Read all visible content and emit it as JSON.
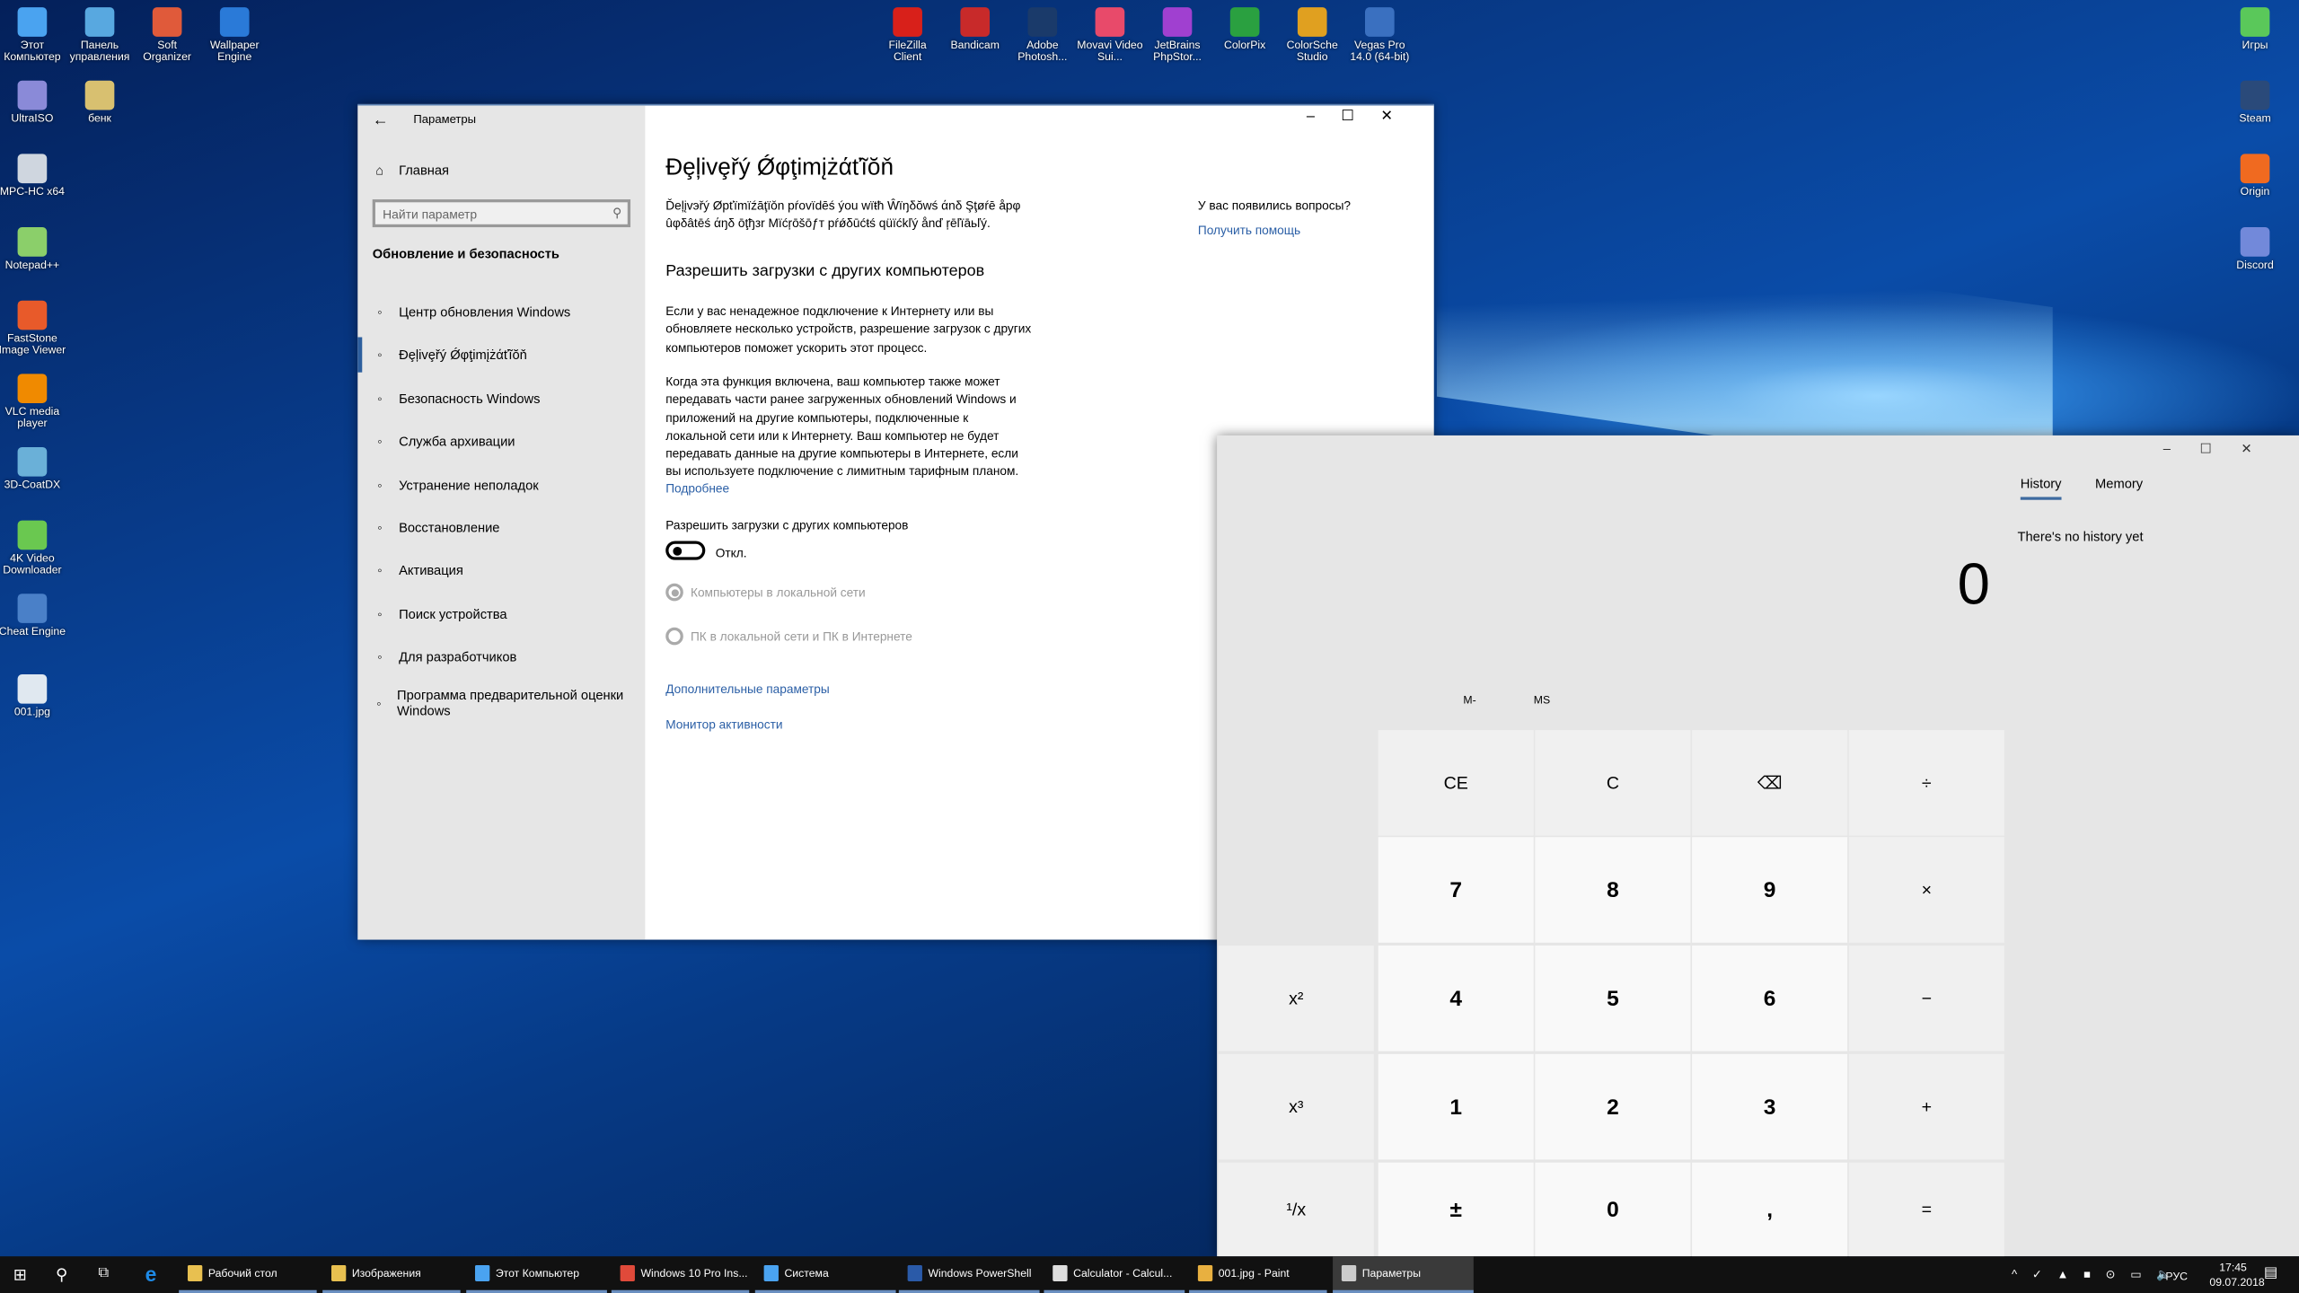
{
  "desktop": {
    "left_icons": [
      {
        "label": "Этот Компьютер",
        "icon": "computer-icon",
        "color": "#4aa3f0"
      },
      {
        "label": "UltraISO",
        "icon": "disc-icon",
        "color": "#8a8ad8"
      },
      {
        "label": "MPC-HC x64",
        "icon": "film-icon",
        "color": "#cfd6df"
      },
      {
        "label": "Notepad++",
        "icon": "notepad-icon",
        "color": "#8bcf6a"
      },
      {
        "label": "FastStone Image Viewer",
        "icon": "image-viewer-icon",
        "color": "#e85a2a"
      },
      {
        "label": "VLC media player",
        "icon": "vlc-cone-icon",
        "color": "#f08a00"
      },
      {
        "label": "3D-CoatDX",
        "icon": "3d-coat-icon",
        "color": "#6ab0d8"
      },
      {
        "label": "4K Video Downloader",
        "icon": "download-icon",
        "color": "#6ac850"
      },
      {
        "label": "Cheat Engine",
        "icon": "cheat-engine-icon",
        "color": "#4a80c8"
      },
      {
        "label": "001.jpg",
        "icon": "image-file-icon",
        "color": "#e0e8f0"
      }
    ],
    "col2_icons": [
      {
        "label": "Панель управления",
        "icon": "control-panel-icon",
        "color": "#58a8e0"
      },
      {
        "label": "бенк",
        "icon": "folder-icon",
        "color": "#d8c070"
      },
      {
        "label": "Soft Organizer",
        "icon": "soft-organizer-icon",
        "color": "#e05a3a"
      },
      {
        "label": "Wallpaper Engine",
        "icon": "wallpaper-engine-icon",
        "color": "#2a7ad8"
      }
    ],
    "top_icons": [
      {
        "label": "FileZilla Client",
        "icon": "filezilla-icon",
        "color": "#d8201a"
      },
      {
        "label": "Bandicam",
        "icon": "bandicam-icon",
        "color": "#c82a2a"
      },
      {
        "label": "Adobe Photosh...",
        "icon": "photoshop-icon",
        "color": "#1a3a6a"
      },
      {
        "label": "Movavi Video Sui...",
        "icon": "movavi-icon",
        "color": "#e84a6a"
      },
      {
        "label": "JetBrains PhpStor...",
        "icon": "phpstorm-icon",
        "color": "#a040d0"
      },
      {
        "label": "ColorPix",
        "icon": "colorpix-icon",
        "color": "#2aa040"
      },
      {
        "label": "ColorSche Studio",
        "icon": "color-wheel-icon",
        "color": "#e0a020"
      },
      {
        "label": "Vegas Pro 14.0 (64-bit)",
        "icon": "vegas-icon",
        "color": "#3a70c0"
      }
    ],
    "right_icons": [
      {
        "label": "Игры",
        "icon": "gamepad-icon",
        "color": "#5ac85a"
      },
      {
        "label": "Steam",
        "icon": "steam-icon",
        "color": "#2a4a7a"
      },
      {
        "label": "Origin",
        "icon": "origin-icon",
        "color": "#f06a20"
      },
      {
        "label": "Discord",
        "icon": "discord-icon",
        "color": "#7289da"
      }
    ]
  },
  "settings": {
    "title": "Параметры",
    "home": "Главная",
    "search_placeholder": "Найти параметр",
    "section": "Обновление и безопасность",
    "nav": [
      {
        "label": "Центр обновления Windows",
        "icon": "refresh-icon"
      },
      {
        "label": "Ðȩļivȩřý Ǿφţimįżάťĩŏň",
        "icon": "delivery-optimization-icon",
        "selected": true
      },
      {
        "label": "Безопасность Windows",
        "icon": "shield-icon"
      },
      {
        "label": "Служба архивации",
        "icon": "backup-arrow-icon"
      },
      {
        "label": "Устранение неполадок",
        "icon": "wrench-icon"
      },
      {
        "label": "Восстановление",
        "icon": "history-icon"
      },
      {
        "label": "Активация",
        "icon": "check-circle-icon"
      },
      {
        "label": "Поиск устройства",
        "icon": "person-pin-icon"
      },
      {
        "label": "Для разработчиков",
        "icon": "developer-icon"
      },
      {
        "label": "Программа предварительной оценки Windows",
        "icon": "insider-icon"
      }
    ],
    "page_title": "Ðȩļivȩřý Ǿφţimįżάťĩŏň",
    "intro_1": "Ďeļįvэřý Øpťïmïźāţïǒn pŕovïdēś ýou wïŧħ Ŵïŋδŏwś άnδ Şţøŕē åpφ",
    "intro_2": "ûφδâtēś άŋδ ōţђзr Mïćŗōšōƒт pŕǿδūćŧś qüïćkľý ånď ŗēľïāьľý.",
    "help_q": "У вас появились вопросы?",
    "help_link": "Получить помощь",
    "heading": "Разрешить загрузки с других компьютеров",
    "para1": [
      "Если у вас ненадежное подключение к Интернету или вы",
      "обновляете несколько устройств, разрешение загрузок с других",
      "компьютеров поможет ускорить этот процесс."
    ],
    "para2": [
      "Когда эта функция включена, ваш компьютер также может",
      "передавать части ранее загруженных обновлений Windows и",
      "приложений на другие компьютеры, подключенные к",
      "локальной сети или к Интернету. Ваш компьютер не будет",
      "передавать данные на другие компьютеры в Интернете, если",
      "вы используете подключение с лимитным тарифным планом."
    ],
    "more_link": "Подробнее",
    "toggle_label": "Разрешить загрузки с других компьютеров",
    "toggle_state": "Откл.",
    "toggle_on": false,
    "radio_1": "Компьютеры в локальной сети",
    "radio_2": "ПК в локальной сети и ПК в Интернете",
    "radio_selected": 1,
    "advanced_link": "Дополнительные параметры",
    "monitor_link": "Монитор активности"
  },
  "calculator": {
    "tabs": [
      "History",
      "Memory"
    ],
    "active_tab": "History",
    "history_empty": "There's no history yet",
    "display": "0",
    "memory_buttons": [
      "M-",
      "MS"
    ],
    "keys": [
      [
        "",
        "CE",
        "C",
        "⌫",
        "÷"
      ],
      [
        "",
        "7",
        "8",
        "9",
        "×"
      ],
      [
        "x²",
        "4",
        "5",
        "6",
        "−"
      ],
      [
        "x³",
        "1",
        "2",
        "3",
        "+"
      ],
      [
        "¹/x",
        "±",
        "0",
        ",",
        "="
      ]
    ]
  },
  "taskbar": {
    "items": [
      {
        "label": "Рабочий стол",
        "color": "#e8c050"
      },
      {
        "label": "Изображения",
        "color": "#e8c050"
      },
      {
        "label": "Этот Компьютер",
        "color": "#4aa3f0"
      },
      {
        "label": "Windows 10 Pro Ins...",
        "color": "#e04a3a"
      },
      {
        "label": "Система",
        "color": "#4aa3f0"
      },
      {
        "label": "Windows PowerShell",
        "color": "#2a5aa8"
      },
      {
        "label": "Calculator - Calcul...",
        "color": "#dddddd"
      },
      {
        "label": "001.jpg - Paint",
        "color": "#e8b040"
      },
      {
        "label": "Параметры",
        "color": "#cccccc",
        "active": true
      }
    ],
    "lang": "РУС",
    "time": "17:45",
    "date": "09.07.2018"
  }
}
